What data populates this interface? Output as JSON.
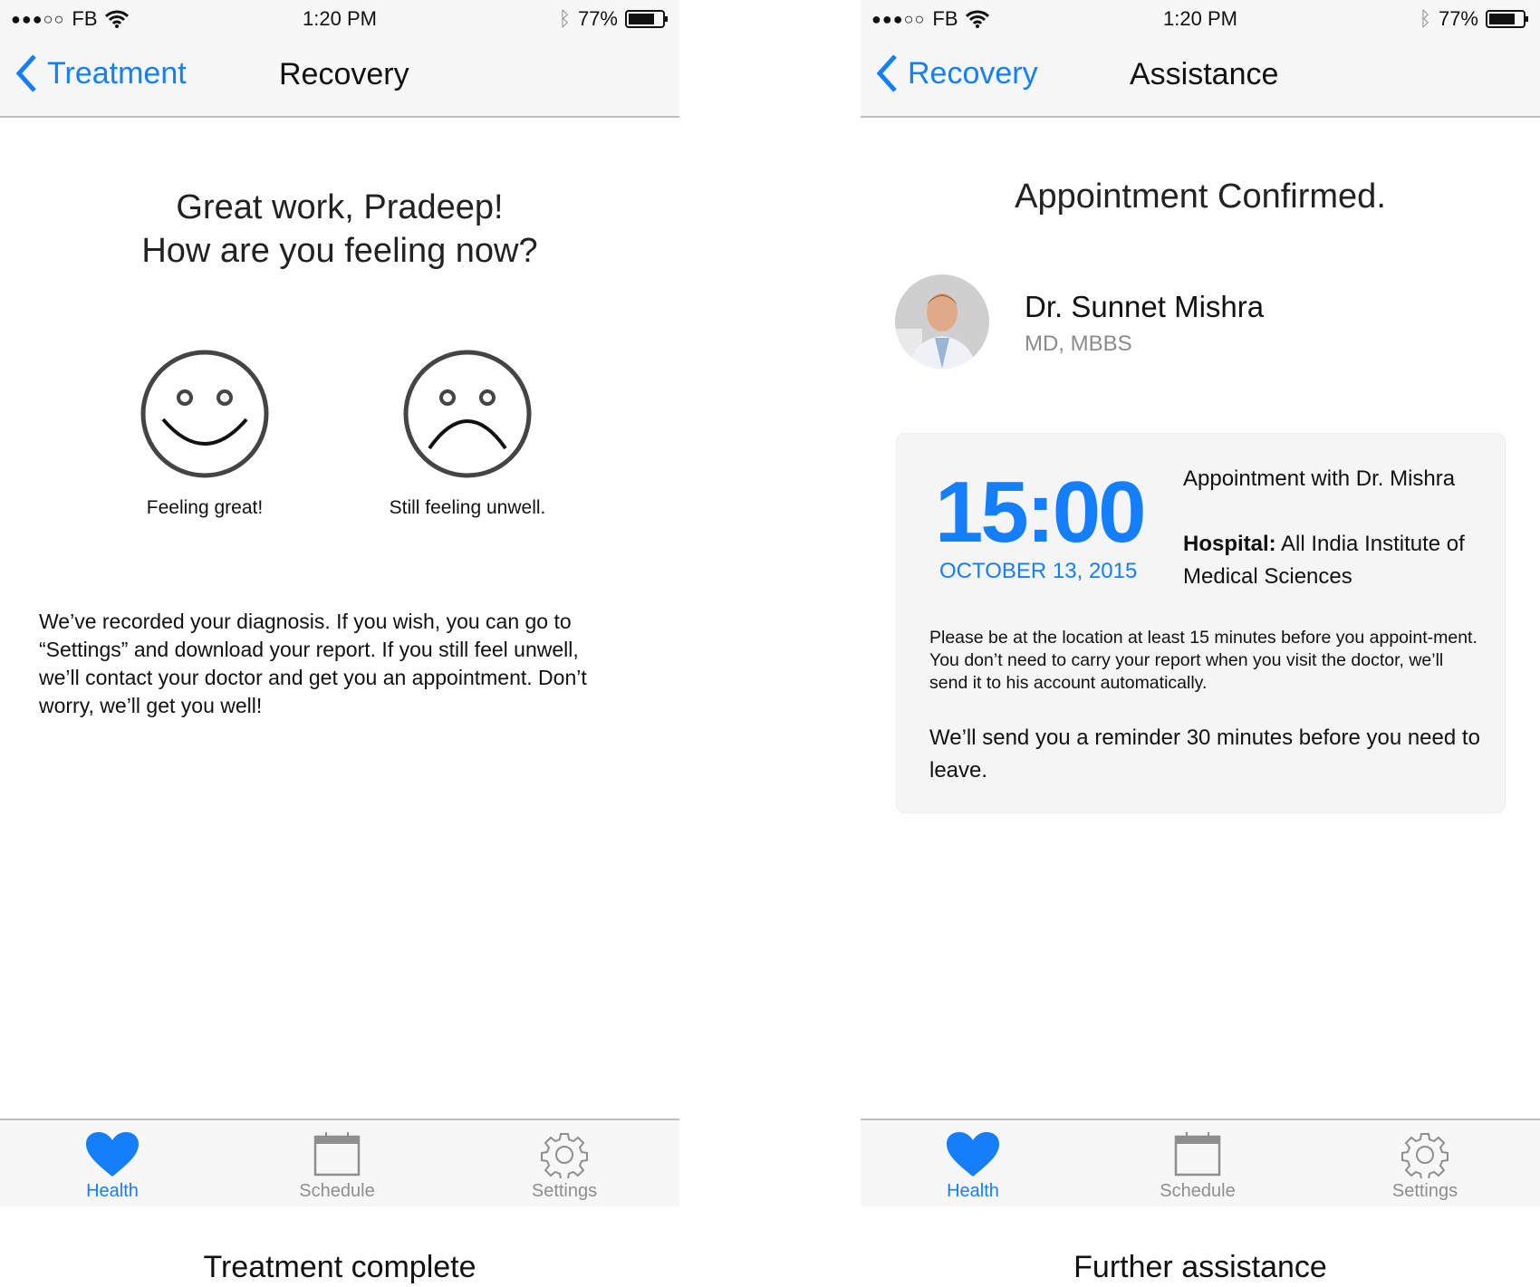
{
  "status_bar": {
    "carrier": "FB",
    "time": "1:20 PM",
    "battery": "77%",
    "battery_level": 0.77,
    "signal_bars": 3,
    "signal_max": 5
  },
  "colors": {
    "accent": "#157efb",
    "card_bg": "#f5f5f5",
    "tab_inactive": "#8e8e8e"
  },
  "screens": [
    {
      "caption": "Treatment complete",
      "nav": {
        "back_label": "Treatment",
        "title": "Recovery"
      },
      "heading": [
        "Great work, Pradeep!",
        "How are you feeling now?"
      ],
      "options": [
        {
          "icon": "smiley-face-icon",
          "label": "Feeling great!"
        },
        {
          "icon": "sad-face-icon",
          "label": "Still feeling unwell."
        }
      ],
      "body": "We’ve recorded your diagnosis. If you wish, you can go to “Settings” and download your report. If you still feel unwell, we’ll contact your doctor and get you an appointment. Don’t worry, we’ll get you well!"
    },
    {
      "caption": "Further assistance",
      "nav": {
        "back_label": "Recovery",
        "title": "Assistance"
      },
      "heading": "Appointment Confirmed.",
      "doctor": {
        "name": "Dr. Sunnet Mishra",
        "qualifications": "MD, MBBS"
      },
      "appointment": {
        "time": "15:00",
        "date": "OCTOBER 13, 2015",
        "with": "Appointment with Dr. Mishra",
        "hospital_label": "Hospital:",
        "hospital": "All India Institute of Medical Sciences",
        "note": "Please be at the location at least 15 minutes before you appoint-ment. You don’t need to carry your report when you visit the doctor, we’ll send it to his account automatically.",
        "reminder": "We’ll send you a reminder 30 minutes before you need to leave."
      }
    }
  ],
  "tabs": [
    {
      "label": "Health",
      "icon": "heart-icon",
      "active": true
    },
    {
      "label": "Schedule",
      "icon": "calendar-icon",
      "active": false
    },
    {
      "label": "Settings",
      "icon": "gear-icon",
      "active": false
    }
  ]
}
